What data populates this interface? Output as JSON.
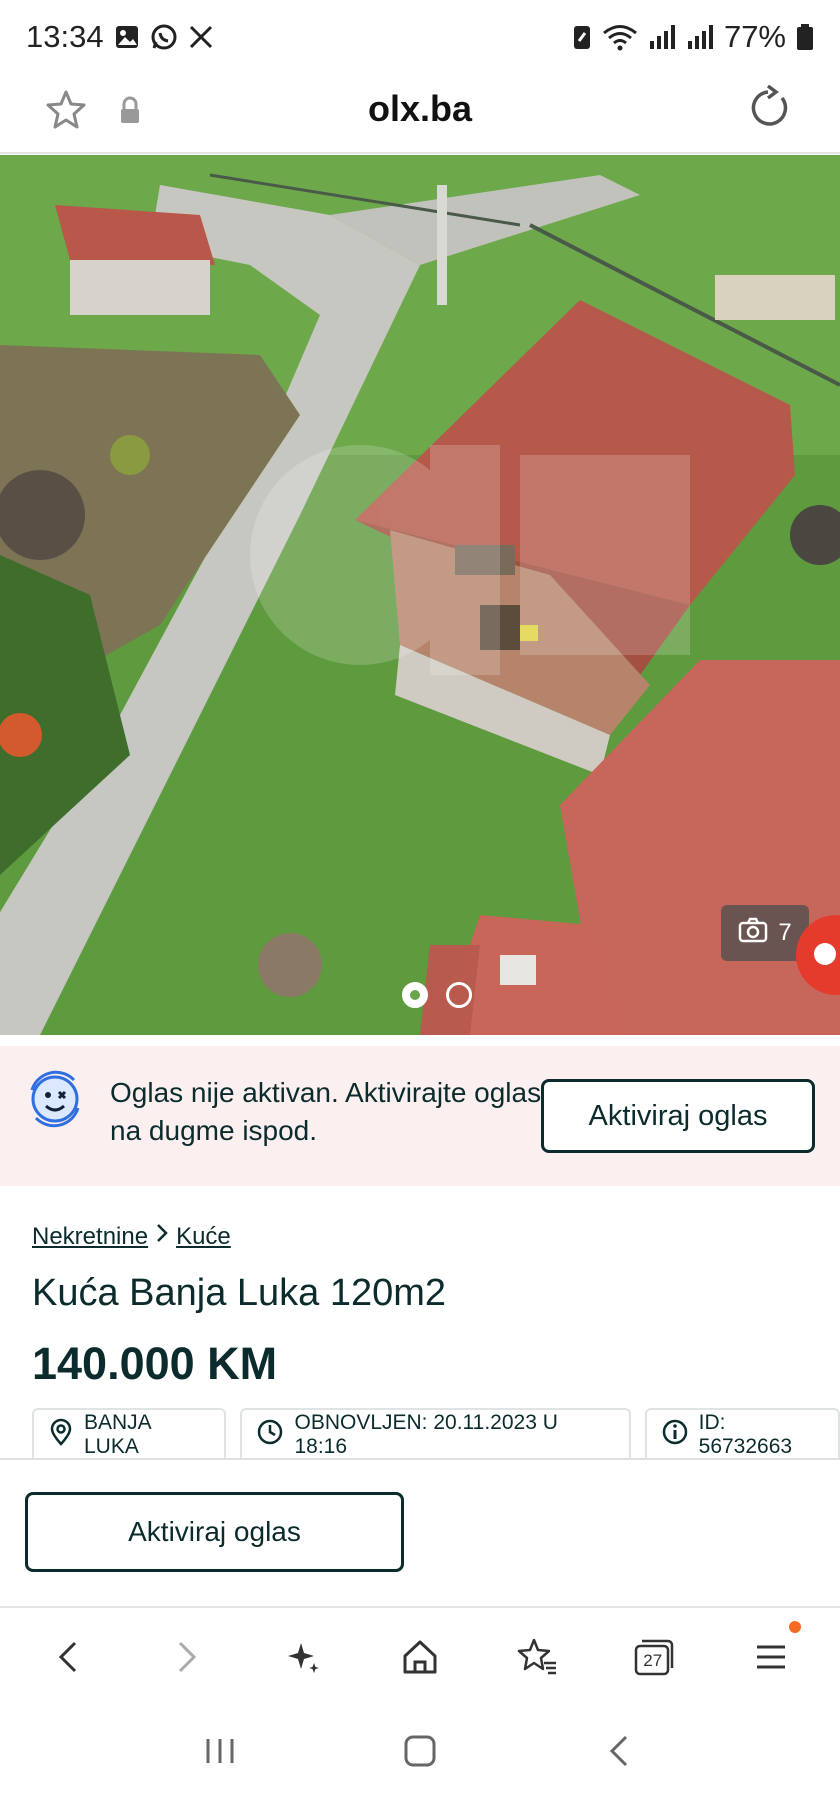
{
  "status_bar": {
    "time": "13:34",
    "battery": "77%",
    "left_icons": [
      "gallery-icon",
      "whatsapp-icon",
      "x-icon"
    ],
    "right_icons": [
      "battery-saver-icon",
      "wifi-icon",
      "signal-icon",
      "signal-icon",
      "battery-icon"
    ]
  },
  "browser": {
    "domain": "olx.ba"
  },
  "gallery": {
    "photo_count": "7",
    "current_index": 1,
    "total_dots": 2
  },
  "notice": {
    "text": "Oglas nije aktivan. Aktivirajte oglas na dugme ispod.",
    "button_label": "Aktiviraj oglas"
  },
  "listing": {
    "breadcrumb": [
      "Nekretnine",
      "Kuće"
    ],
    "title": "Kuća Banja Luka 120m2",
    "price": "140.000 KM",
    "chips": [
      {
        "icon": "location-pin-icon",
        "text": "BANJA LUKA"
      },
      {
        "icon": "clock-icon",
        "text": "OBNOVLJEN: 20.11.2023 U 18:16"
      },
      {
        "icon": "info-icon",
        "text": "ID: 56732663"
      }
    ]
  },
  "bottom_sheet": {
    "button_label": "Aktiviraj oglas"
  },
  "browser_nav": {
    "items": [
      "back-icon",
      "forward-icon",
      "sparkle-icon",
      "home-icon",
      "bookmarks-icon",
      "tabs-icon",
      "menu-icon"
    ],
    "tabs_count": "27"
  },
  "colors": {
    "brand_dark": "#0b2b2d",
    "notice_bg": "#fbefef",
    "fab_red": "#e53b2d",
    "notif_orange": "#f26b21"
  }
}
